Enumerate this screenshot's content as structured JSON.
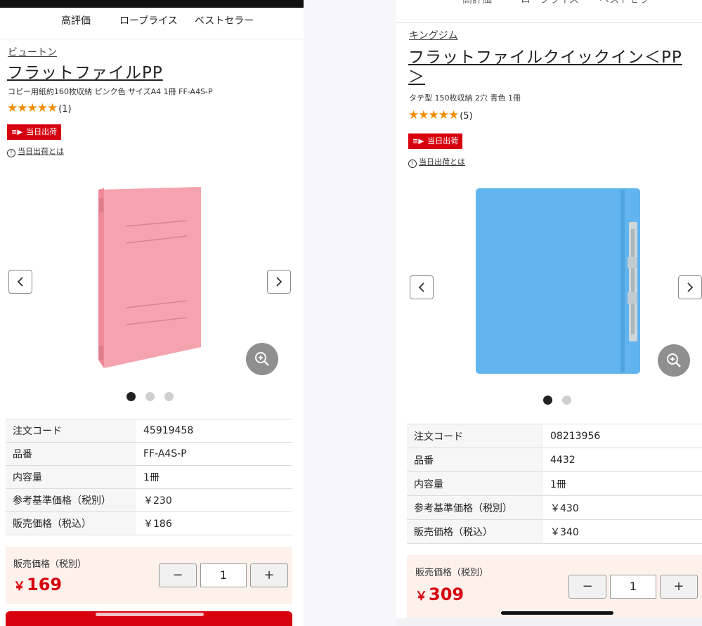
{
  "left": {
    "tabs": [
      "高評価",
      "ロープライス",
      "ベストセラー"
    ],
    "brand": "ビュートン",
    "title": "フラットファイルPP",
    "subtitle": "コピー用紙約160枚収納 ピンク色 サイズA4 1冊 FF-A4S-P",
    "rating": 5,
    "review_count": "(1)",
    "ship_badge": "当日出荷",
    "ship_link": "当日出荷とは",
    "image_color": "#f5a3ae",
    "specs": [
      {
        "key": "注文コード",
        "value": "45919458"
      },
      {
        "key": "品番",
        "value": "FF-A4S-P"
      },
      {
        "key": "内容量",
        "value": "1冊"
      },
      {
        "key": "参考基準価格（税別）",
        "value": "￥230"
      },
      {
        "key": "販売価格（税込）",
        "value": "￥186"
      }
    ],
    "price_label": "販売価格（税別）",
    "price_yen": "￥",
    "price": "169",
    "quantity": "1",
    "minus": "−",
    "plus": "+"
  },
  "right": {
    "tabs_partial": [
      "高評価",
      "ロープライス",
      "ベストセラー"
    ],
    "brand": "キングジム",
    "title_line1": "フラットファイルクイックイン＜PP",
    "title_line2": "＞",
    "subtitle": "タテ型 150枚収納 2穴 青色 1冊",
    "rating": 5,
    "review_count": "(5)",
    "ship_badge": "当日出荷",
    "ship_link": "当日出荷とは",
    "image_color": "#62b4ef",
    "specs": [
      {
        "key": "注文コード",
        "value": "08213956"
      },
      {
        "key": "品番",
        "value": "4432"
      },
      {
        "key": "内容量",
        "value": "1冊"
      },
      {
        "key": "参考基準価格（税別）",
        "value": "￥430"
      },
      {
        "key": "販売価格（税込）",
        "value": "￥340"
      }
    ],
    "price_label": "販売価格（税別）",
    "price_yen": "￥",
    "price": "309",
    "quantity": "1",
    "minus": "−",
    "plus": "+"
  },
  "colors": {
    "accent_red": "#d7000f",
    "star": "#f18d00"
  },
  "icons": [
    "truck-icon",
    "info-icon",
    "chevron-left-icon",
    "chevron-right-icon",
    "zoom-in-icon"
  ]
}
